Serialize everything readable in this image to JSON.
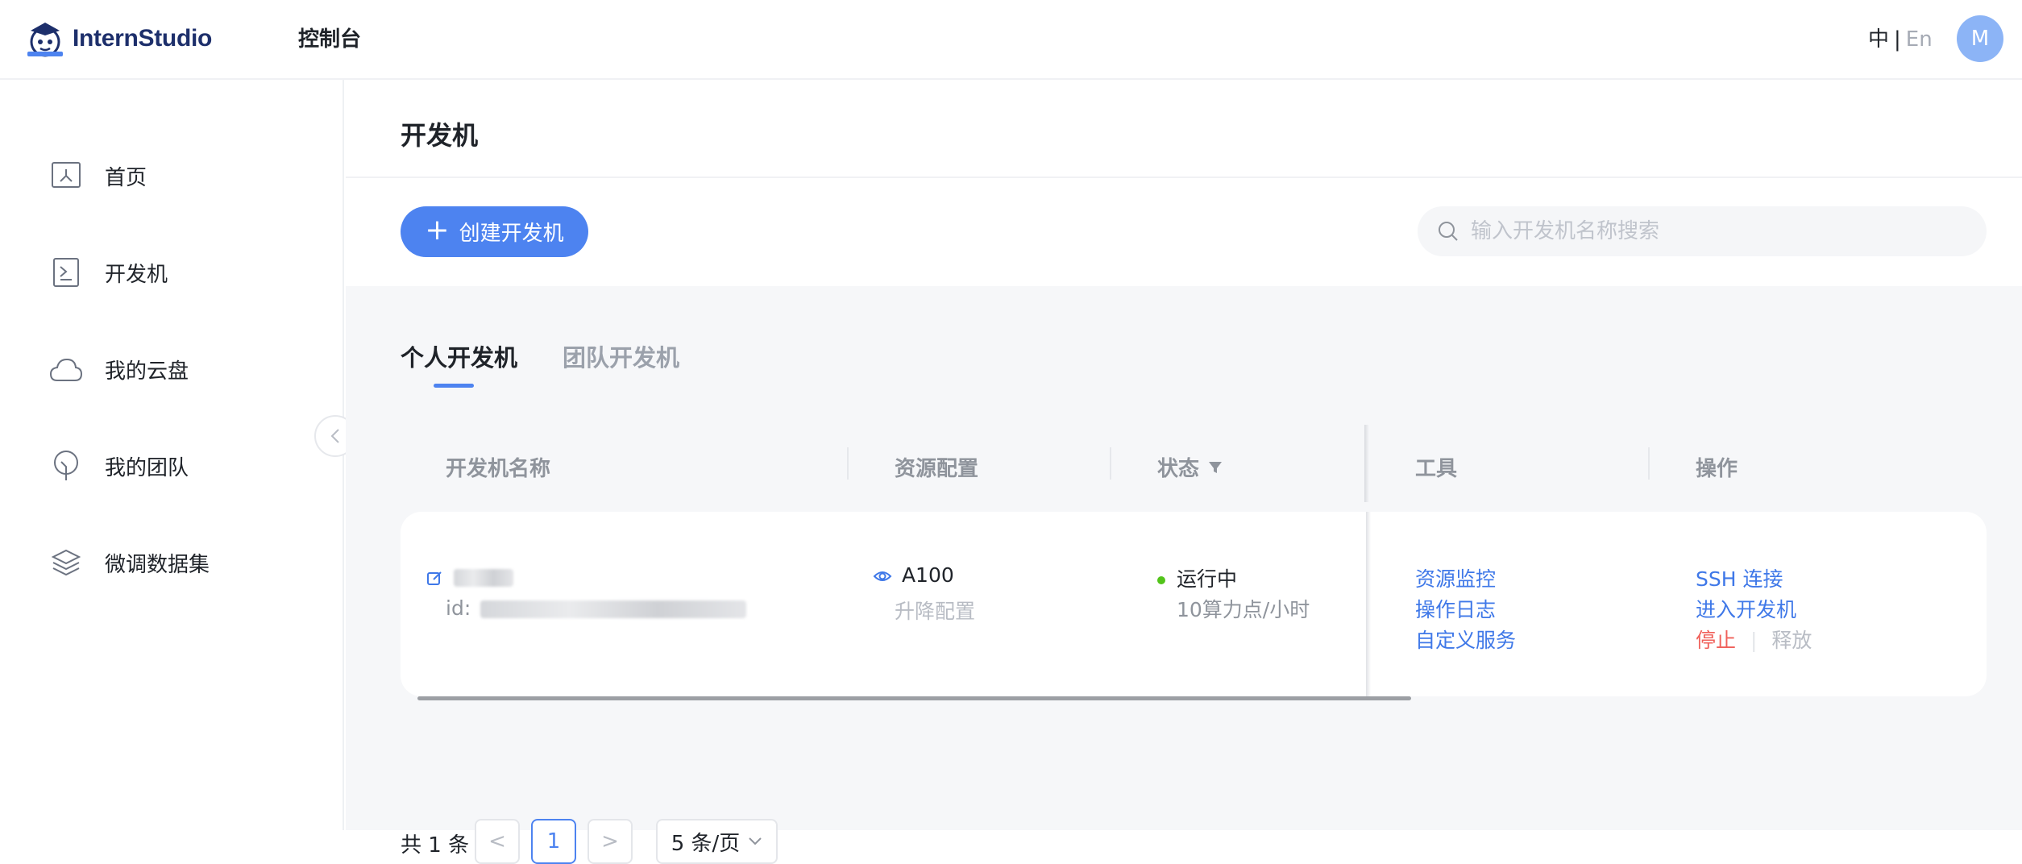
{
  "header": {
    "logo_text": "InternStudio",
    "console_title": "控制台",
    "lang_zh": "中",
    "lang_sep": "|",
    "lang_en": "En",
    "avatar_initial": "M"
  },
  "sidebar": {
    "items": [
      {
        "label": "首页",
        "icon": "home-icon"
      },
      {
        "label": "开发机",
        "icon": "terminal-icon"
      },
      {
        "label": "我的云盘",
        "icon": "cloud-icon"
      },
      {
        "label": "我的团队",
        "icon": "location-pin-icon"
      },
      {
        "label": "微调数据集",
        "icon": "layers-icon"
      }
    ]
  },
  "main": {
    "page_title": "开发机",
    "create_button": "创建开发机",
    "search_placeholder": "输入开发机名称搜索",
    "tabs": [
      {
        "label": "个人开发机",
        "active": true
      },
      {
        "label": "团队开发机",
        "active": false
      }
    ],
    "table": {
      "columns": [
        "开发机名称",
        "资源配置",
        "状态",
        "工具",
        "操作"
      ],
      "rows": [
        {
          "id_prefix": "id:",
          "resource": "A100",
          "resource_action": "升降配置",
          "status": "运行中",
          "status_rate": "10算力点/小时",
          "tools": [
            "资源监控",
            "操作日志",
            "自定义服务"
          ],
          "actions": {
            "ssh": "SSH 连接",
            "enter": "进入开发机",
            "stop": "停止",
            "sep": "|",
            "release": "释放"
          }
        }
      ]
    },
    "pagination": {
      "total": "共 1 条",
      "prev": "<",
      "current_page": "1",
      "next": ">",
      "page_size": "5 条/页"
    }
  },
  "colors": {
    "accent": "#4d83f0",
    "link": "#3f78e8",
    "danger": "#f0605a",
    "running": "#52c41a",
    "avatar_bg": "#8cb4f6"
  }
}
